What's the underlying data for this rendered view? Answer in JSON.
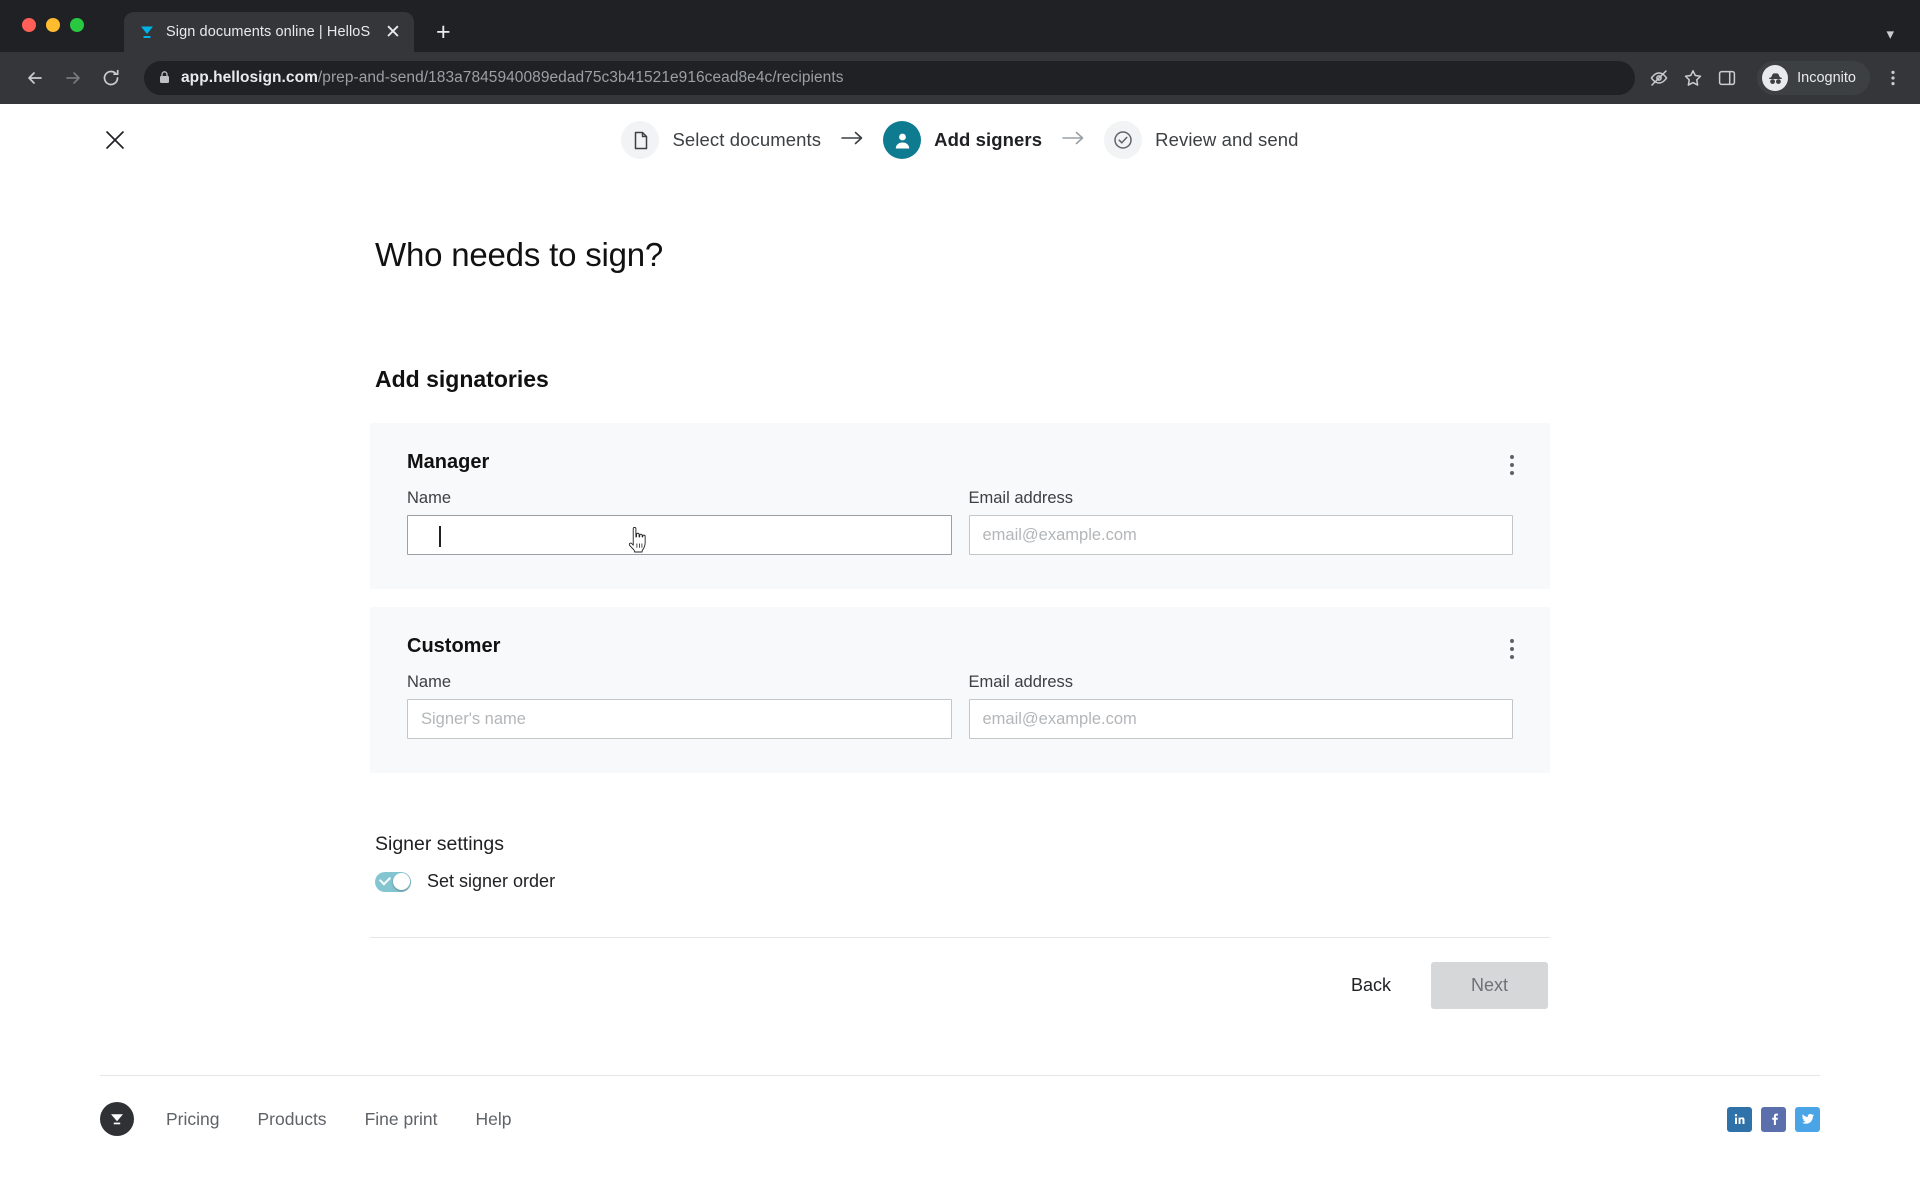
{
  "browser": {
    "tab": {
      "title": "Sign documents online | HelloS",
      "favicon_icon": "hellosign-logo-icon",
      "close_icon": "close-icon"
    },
    "new_tab_icon": "plus-icon",
    "tabstrip_expand_icon": "chevron-down-icon",
    "nav": {
      "back_icon": "arrow-left-icon",
      "forward_icon": "arrow-right-icon",
      "reload_icon": "reload-icon"
    },
    "omnibox": {
      "lock_icon": "lock-icon",
      "host": "app.hellosign.com",
      "path": "/prep-and-send/183a7845940089edad75c3b41521e916cead8e4c/recipients"
    },
    "toolbar_icons": {
      "third_party_cookies_icon": "eye-slash-icon",
      "bookmark_icon": "star-icon",
      "side_panel_icon": "side-panel-icon",
      "menu_icon": "kebab-menu-icon"
    },
    "incognito": {
      "label": "Incognito",
      "avatar_icon": "incognito-hat-icon"
    }
  },
  "app": {
    "close_icon": "close-icon",
    "stepper": {
      "arrow_icon": "arrow-right-icon",
      "steps": [
        {
          "label": "Select documents",
          "icon": "document-icon",
          "state": "inactive"
        },
        {
          "label": "Add signers",
          "icon": "person-icon",
          "state": "active"
        },
        {
          "label": "Review and send",
          "icon": "check-circle-icon",
          "state": "inactive"
        }
      ]
    },
    "heading": "Who needs to sign?",
    "section_title": "Add signatories",
    "signers": [
      {
        "role": "Manager",
        "menu_icon": "kebab-menu-icon",
        "name_label": "Name",
        "name_value": "",
        "name_placeholder": "",
        "name_focused": true,
        "email_label": "Email address",
        "email_value": "",
        "email_placeholder": "email@example.com"
      },
      {
        "role": "Customer",
        "menu_icon": "kebab-menu-icon",
        "name_label": "Name",
        "name_value": "",
        "name_placeholder": "Signer's name",
        "name_focused": false,
        "email_label": "Email address",
        "email_value": "",
        "email_placeholder": "email@example.com"
      }
    ],
    "settings": {
      "title": "Signer settings",
      "toggle_label": "Set signer order",
      "toggle_state": "on"
    },
    "buttons": {
      "back": "Back",
      "next": "Next",
      "next_disabled": true
    },
    "footer": {
      "logo_icon": "hellosign-logo-icon",
      "links": [
        {
          "label": "Pricing"
        },
        {
          "label": "Products"
        },
        {
          "label": "Fine print"
        },
        {
          "label": "Help"
        }
      ],
      "social": [
        {
          "name": "linkedin-icon",
          "label": "in"
        },
        {
          "name": "facebook-icon",
          "label": "f"
        },
        {
          "name": "twitter-icon",
          "label": "t"
        }
      ]
    }
  },
  "colors": {
    "accent_teal": "#0f7b91",
    "toggle_on": "#84c5d2",
    "chrome_dark": "#202124",
    "chrome_toolbar": "#35363a",
    "card_bg": "#f8f9fa"
  }
}
